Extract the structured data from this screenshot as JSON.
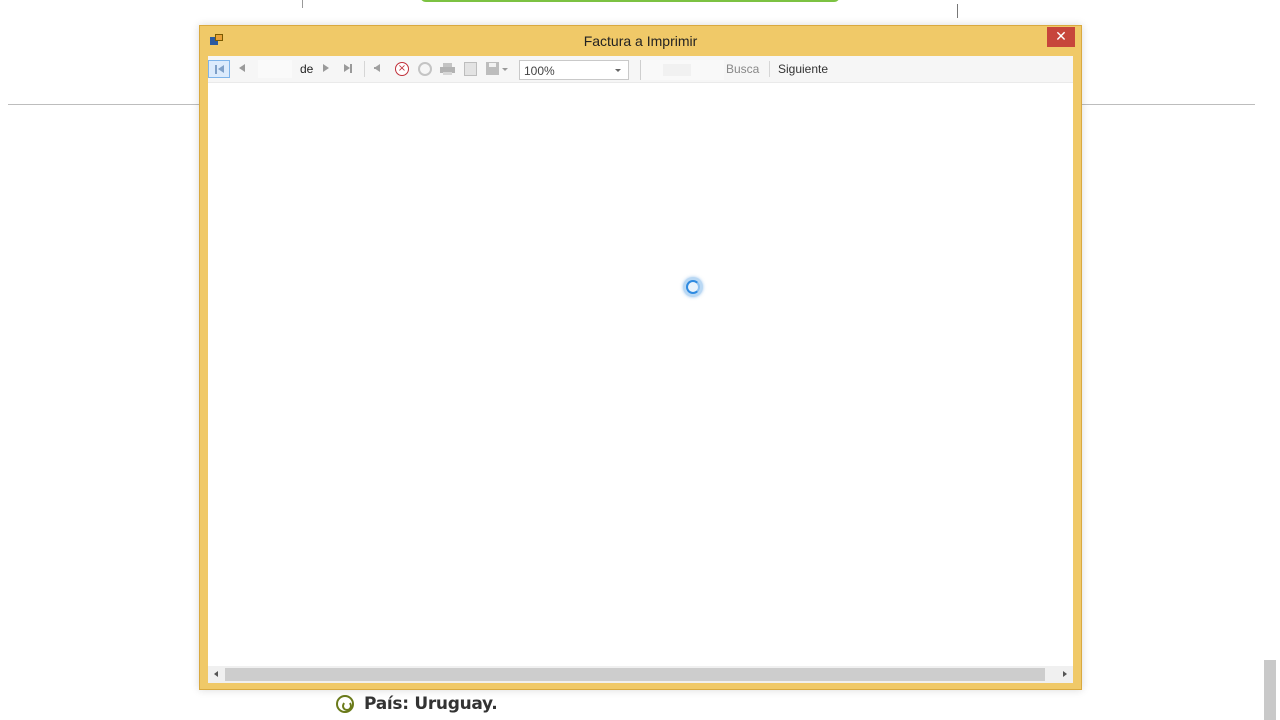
{
  "window": {
    "title": "Factura a Imprimir",
    "close_label": "✕",
    "accent_color": "#f0c968",
    "close_color": "#c7453b"
  },
  "toolbar": {
    "page_value": "",
    "of_label": "de",
    "zoom_value": "100%",
    "zoom_options": [
      "100%"
    ],
    "search_value": "",
    "find_label": "Buscar",
    "next_label": "Siguiente",
    "icons": [
      "first-page-icon",
      "previous-page-icon",
      "next-page-icon",
      "last-page-icon",
      "back-icon",
      "stop-icon",
      "refresh-icon",
      "print-icon",
      "print-layout-icon",
      "export-icon"
    ]
  },
  "viewer": {
    "state": "loading",
    "spinner_icon": "loading-spinner-icon"
  },
  "background": {
    "footer_text": "País: Uruguay."
  }
}
